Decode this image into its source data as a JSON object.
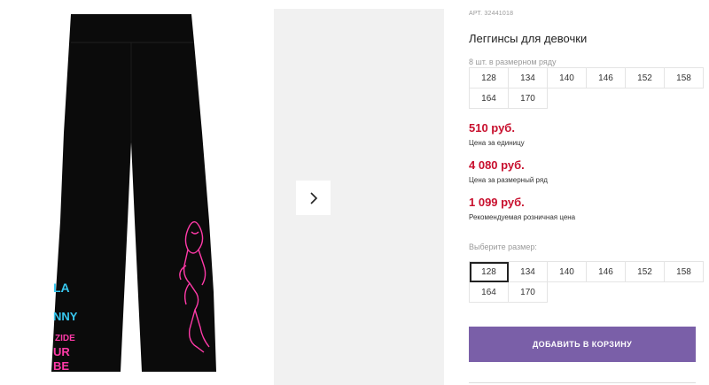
{
  "product": {
    "article": "АРТ. 32441018",
    "title": "Леггинсы для девочки",
    "pack_note": "8 шт. в размерном ряду"
  },
  "pack_sizes": [
    "128",
    "134",
    "140",
    "146",
    "152",
    "158",
    "164",
    "170"
  ],
  "prices": {
    "unit_price": "510 руб.",
    "unit_label": "Цена за единицу",
    "pack_price": "4 080 руб.",
    "pack_label": "Цена за размерный ряд",
    "retail_price": "1 099 руб.",
    "retail_label": "Рекомендуемая розничная цена"
  },
  "size_select": {
    "label": "Выберите размер:",
    "options": [
      "128",
      "134",
      "140",
      "146",
      "152",
      "158",
      "164",
      "170"
    ],
    "selected": "128"
  },
  "cart": {
    "add_label": "ДОБАВИТЬ В КОРЗИНУ"
  },
  "gallery": {
    "next_icon": "chevron-right-icon"
  },
  "colors": {
    "price": "#c8102e",
    "button": "#7a5fa8",
    "garment": "#0b0b0b",
    "print_pink": "#ff3aa8",
    "print_blue": "#38c8f0"
  }
}
